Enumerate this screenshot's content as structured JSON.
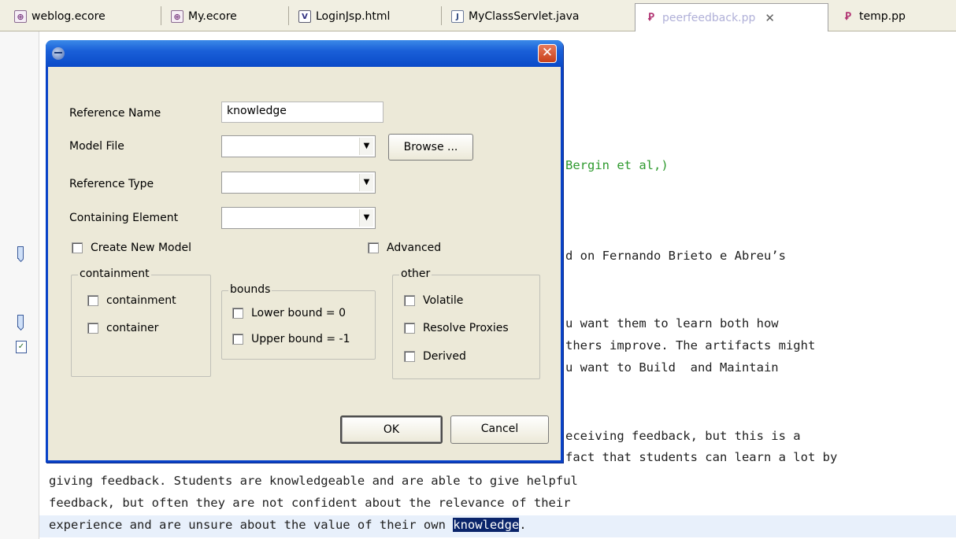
{
  "tabs": [
    {
      "label": "weblog.ecore",
      "icon": "ecore-file-icon"
    },
    {
      "label": "My.ecore",
      "icon": "ecore-file-icon"
    },
    {
      "label": "LoginJsp.html",
      "icon": "html-file-icon"
    },
    {
      "label": "MyClassServlet.java",
      "icon": "java-file-icon"
    },
    {
      "label": "peerfeedback.pp",
      "icon": "pp-file-icon",
      "active": true
    },
    {
      "label": "temp.pp",
      "icon": "pp-file-icon"
    }
  ],
  "editor": {
    "fragments": [
      "Bergin et al,)",
      "d on Fernando Brieto e Abreu’s",
      "u want them to learn both how",
      "thers improve. The artifacts might",
      "u want to Build  and Maintain",
      "eceiving feedback, but this is a",
      "fact that students can learn a lot by"
    ],
    "lines": [
      "giving feedback. Students are knowledgeable and are able to give helpful",
      "feedback, but often they are not confident about the relevance of their"
    ],
    "last_line_prefix": "experience and are unsure about the value of their own ",
    "last_line_selected": "knowledge",
    "last_line_suffix": "."
  },
  "dialog": {
    "reference_name_label": "Reference Name",
    "reference_name_value": "knowledge",
    "model_file_label": "Model File",
    "model_file_value": "",
    "browse_button": "Browse ...",
    "reference_type_label": "Reference Type",
    "reference_type_value": "",
    "containing_element_label": "Containing Element",
    "containing_element_value": "",
    "create_new_model": "Create New Model",
    "advanced": "Advanced",
    "containment_group": {
      "title": "containment",
      "options": [
        "containment",
        "container"
      ]
    },
    "bounds_group": {
      "title": "bounds",
      "options": [
        "Lower bound = 0",
        "Upper bound = -1"
      ]
    },
    "other_group": {
      "title": "other",
      "options": [
        "Volatile",
        "Resolve Proxies",
        "Derived"
      ]
    },
    "ok_button": "OK",
    "cancel_button": "Cancel"
  }
}
